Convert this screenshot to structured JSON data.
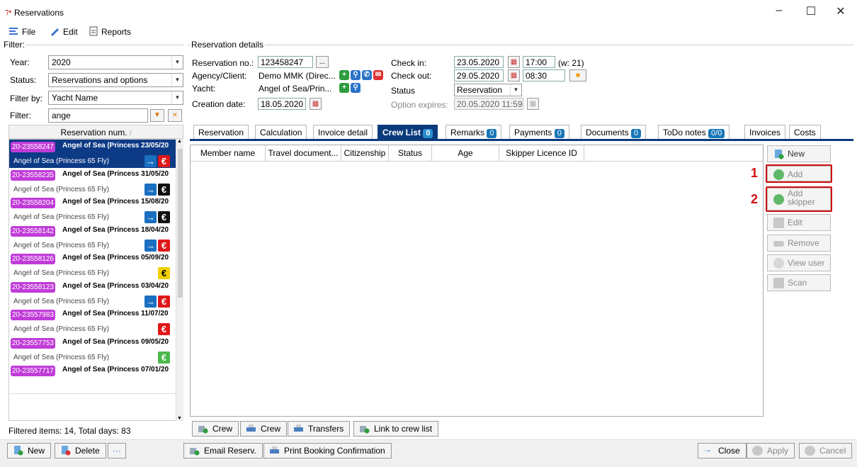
{
  "window": {
    "title": "Reservations"
  },
  "menu": {
    "file": "File",
    "edit": "Edit",
    "reports": "Reports"
  },
  "filter": {
    "group_label": "Filter:",
    "year_label": "Year:",
    "year_value": "2020",
    "status_label": "Status:",
    "status_value": "Reservations and options",
    "filterby_label": "Filter by:",
    "filterby_value": "Yacht Name",
    "filter_label": "Filter:",
    "filter_value": "ange",
    "list_header": "Reservation num.",
    "items": [
      {
        "num": "20-23558247",
        "title": "Angel of Sea (Princess 23/05/20",
        "sub": "Angel of Sea (Princess 65 Fly)",
        "icons": [
          "arrow",
          "euro-red"
        ]
      },
      {
        "num": "20-23558235",
        "title": "Angel of Sea (Princess 31/05/20",
        "sub": "Angel of Sea (Princess 65 Fly)",
        "icons": [
          "arrow",
          "euro-black"
        ]
      },
      {
        "num": "20-23558204",
        "title": "Angel of Sea (Princess 15/08/20",
        "sub": "Angel of Sea (Princess 65 Fly)",
        "icons": [
          "arrow",
          "euro-black"
        ]
      },
      {
        "num": "20-23558142",
        "title": "Angel of Sea (Princess 18/04/20",
        "sub": "Angel of Sea (Princess 65 Fly)",
        "icons": [
          "arrow",
          "euro-red"
        ]
      },
      {
        "num": "20-23558126",
        "title": "Angel of Sea (Princess 05/09/20",
        "sub": "Angel of Sea (Princess 65 Fly)",
        "icons": [
          "euro-yellow"
        ]
      },
      {
        "num": "20-23558123",
        "title": "Angel of Sea (Princess 03/04/20",
        "sub": "Angel of Sea (Princess 65 Fly)",
        "icons": [
          "arrow",
          "euro-red"
        ]
      },
      {
        "num": "20-23557983",
        "title": "Angel of Sea (Princess 11/07/20",
        "sub": "Angel of Sea (Princess 65 Fly)",
        "icons": [
          "euro-red"
        ]
      },
      {
        "num": "20-23557753",
        "title": "Angel of Sea (Princess 09/05/20",
        "sub": "Angel of Sea (Princess 65 Fly)",
        "icons": [
          "euro-green"
        ]
      },
      {
        "num": "20-23557717",
        "title": "Angel of Sea (Princess 07/01/20",
        "sub": "",
        "icons": []
      }
    ],
    "footer": "Filtered items: 14,  Total days: 83"
  },
  "details": {
    "group_label": "Reservation details",
    "resno_label": "Reservation no.:",
    "resno_value": "123458247",
    "resno_btn": "...",
    "agency_label": "Agency/Client:",
    "agency_value": "Demo MMK (Direc...",
    "yacht_label": "Yacht:",
    "yacht_value": "Angel of Sea/Prin...",
    "created_label": "Creation date:",
    "created_value": "18.05.2020",
    "checkin_label": "Check in:",
    "checkin_date": "23.05.2020",
    "checkin_time": "17:00",
    "checkin_week": "(w: 21)",
    "checkout_label": "Check out:",
    "checkout_date": "29.05.2020",
    "checkout_time": "08:30",
    "status_label": "Status",
    "status_value": "Reservation",
    "option_label": "Option expires:",
    "option_value": "20.05.2020 11:59"
  },
  "tabs": [
    {
      "label": "Reservation",
      "badge": ""
    },
    {
      "label": "Calculation",
      "badge": ""
    },
    {
      "label": "Invoice detail",
      "badge": ""
    },
    {
      "label": "Crew List",
      "badge": "0"
    },
    {
      "label": "Remarks",
      "badge": "0"
    },
    {
      "label": "Payments",
      "badge": "0"
    },
    {
      "label": "Documents",
      "badge": "0"
    },
    {
      "label": "ToDo notes",
      "badge": "0/0"
    },
    {
      "label": "Invoices",
      "badge": ""
    },
    {
      "label": "Costs",
      "badge": ""
    }
  ],
  "grid": {
    "columns": [
      "Member name",
      "Travel document...",
      "Citizenship",
      "Status",
      "Age",
      "Skipper Licence ID"
    ]
  },
  "side_buttons": {
    "new": "New",
    "add": "Add",
    "add_skipper_1": "Add",
    "add_skipper_2": "skipper",
    "edit": "Edit",
    "remove": "Remove",
    "view_user": "View user",
    "scan": "Scan"
  },
  "markers": {
    "one": "1",
    "two": "2"
  },
  "crew_buttons": {
    "crew_add": "Crew",
    "crew_print": "Crew",
    "transfers": "Transfers",
    "link": "Link to crew list"
  },
  "bottom": {
    "new": "New",
    "delete": "Delete",
    "more": "···",
    "email": "Email Reserv.",
    "print": "Print Booking Confirmation",
    "close": "Close",
    "apply": "Apply",
    "cancel": "Cancel"
  },
  "colors": {
    "accent": "#0b3a7c",
    "highlight": "#d01010",
    "badge": "#1877b8",
    "resnum": "#c03cd8"
  }
}
